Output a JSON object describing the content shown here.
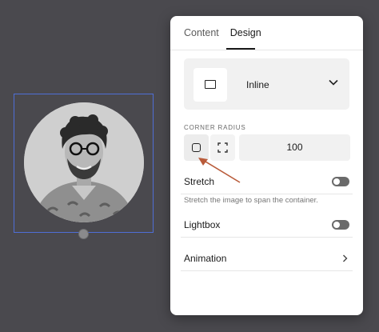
{
  "tabs": [
    {
      "label": "Content",
      "active": false
    },
    {
      "label": "Design",
      "active": true
    }
  ],
  "layout": {
    "label": "Inline",
    "icon": "inline-layout-icon"
  },
  "corner_radius": {
    "label": "CORNER RADIUS",
    "options": [
      {
        "icon": "rounded-square-icon",
        "selected": true
      },
      {
        "icon": "corners-icon",
        "selected": false
      }
    ],
    "value": "100"
  },
  "stretch": {
    "label": "Stretch",
    "description": "Stretch the image to span the container.",
    "enabled": false
  },
  "lightbox": {
    "label": "Lightbox",
    "enabled": false
  },
  "animation": {
    "label": "Animation"
  },
  "colors": {
    "selection": "#4f6ed6",
    "toggle_off": "#6a6a6a",
    "annotation_arrow": "#b95b3a",
    "canvas_bg": "#4a494e"
  }
}
